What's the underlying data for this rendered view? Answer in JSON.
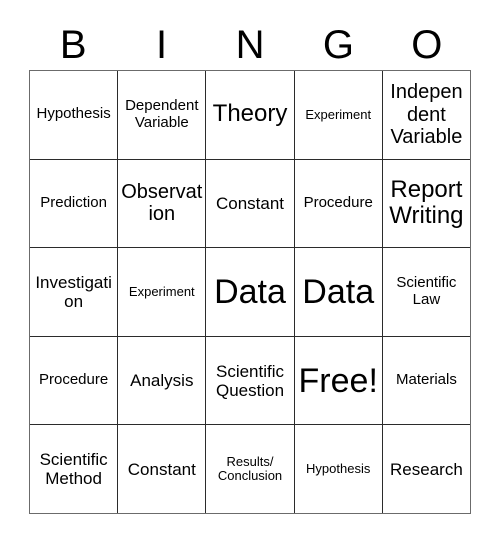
{
  "card": {
    "header_letters": [
      "B",
      "I",
      "N",
      "G",
      "O"
    ],
    "rows": [
      [
        {
          "text": "Hypothesis",
          "size": "fs-s"
        },
        {
          "text": "Dependent Variable",
          "size": "fs-s"
        },
        {
          "text": "Theory",
          "size": "fs-xl"
        },
        {
          "text": "Experiment",
          "size": "fs-xs"
        },
        {
          "text": "Independent Variable",
          "size": "fs-l"
        }
      ],
      [
        {
          "text": "Prediction",
          "size": "fs-s"
        },
        {
          "text": "Observation",
          "size": "fs-l"
        },
        {
          "text": "Constant",
          "size": "fs-m"
        },
        {
          "text": "Procedure",
          "size": "fs-s"
        },
        {
          "text": "Report Writing",
          "size": "fs-xl"
        }
      ],
      [
        {
          "text": "Investigation",
          "size": "fs-m"
        },
        {
          "text": "Experiment",
          "size": "fs-xs"
        },
        {
          "text": "Data",
          "size": "fs-xxl"
        },
        {
          "text": "Data",
          "size": "fs-xxl"
        },
        {
          "text": "Scientific Law",
          "size": "fs-s"
        }
      ],
      [
        {
          "text": "Procedure",
          "size": "fs-s"
        },
        {
          "text": "Analysis",
          "size": "fs-m"
        },
        {
          "text": "Scientific Question",
          "size": "fs-m"
        },
        {
          "text": "Free!",
          "size": "fs-xxl"
        },
        {
          "text": "Materials",
          "size": "fs-s"
        }
      ],
      [
        {
          "text": "Scientific Method",
          "size": "fs-m"
        },
        {
          "text": "Constant",
          "size": "fs-m"
        },
        {
          "text": "Results/ Conclusion",
          "size": "fs-xs"
        },
        {
          "text": "Hypothesis",
          "size": "fs-xs"
        },
        {
          "text": "Research",
          "size": "fs-m"
        }
      ]
    ]
  }
}
